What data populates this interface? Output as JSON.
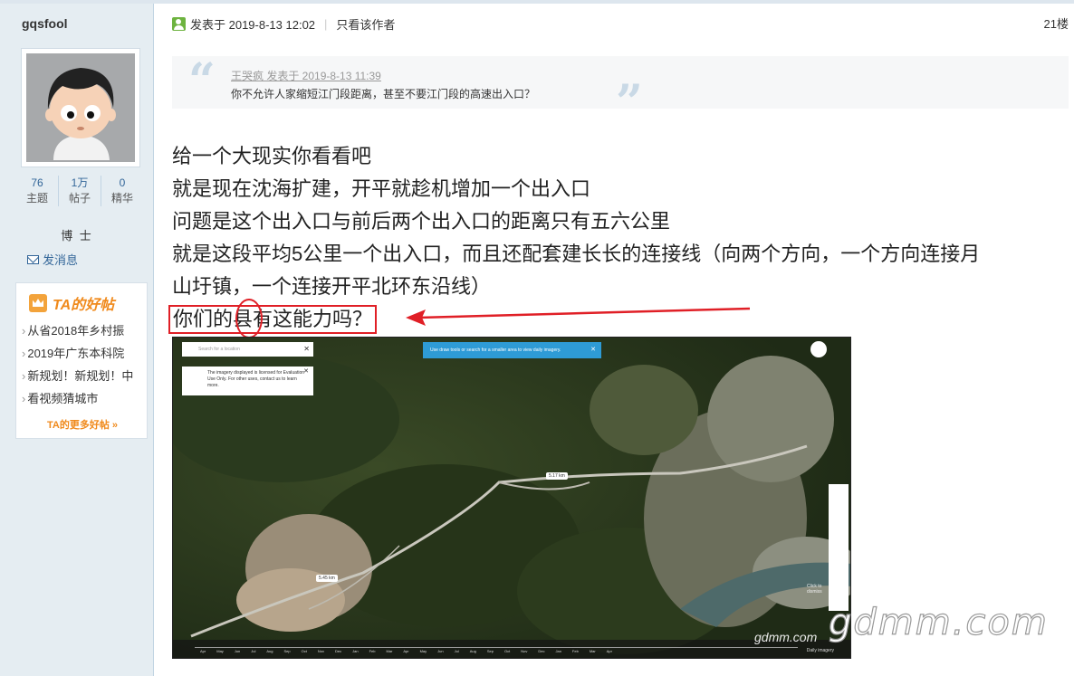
{
  "sidebar": {
    "username": "gqsfool",
    "stats": [
      {
        "num": "76",
        "label": "主题"
      },
      {
        "num": "1万",
        "label": "帖子"
      },
      {
        "num": "0",
        "label": "精华"
      }
    ],
    "rank": "博 士",
    "pm_label": "发消息",
    "hot": {
      "title": "TA的好帖",
      "items": [
        "从省2018年乡村振",
        "2019年广东本科院",
        "新规划！新规划！中",
        "看视频猜城市"
      ],
      "more": "TA的更多好帖 »"
    }
  },
  "post": {
    "posted": "发表于 2019-8-13 12:02",
    "only_author": "只看该作者",
    "floor": "21楼",
    "quote": {
      "meta": "王哭疯 发表于 2019-8-13 11:39",
      "text": "你不允许人家缩短江门段距离，甚至不要江门段的高速出入口？"
    },
    "lines": [
      "给一个大现实你看看吧",
      "就是现在沈海扩建，开平就趁机增加一个出入口",
      "问题是这个出入口与前后两个出入口的距离只有五六公里",
      "就是这段平均5公里一个出入口，而且还配套建长长的连接线（向两个方向，一个方向连接月",
      "山圩镇，一个连接开平北环东沿线）"
    ],
    "highlight": "你们的县有这能力吗？"
  },
  "map": {
    "search_placeholder": "Search for a location",
    "license": "The imagery displayed is licensed for Evaluation Use Only. For other uses, contact us to learn more.",
    "draw_tip": "Use draw tools or search for a smaller area to view daily imagery.",
    "dist1": "5.17 km",
    "dist2": "5.45 km",
    "click_note": "Click to dismiss",
    "daily": "Daily imagery",
    "months": [
      "Apr",
      "May",
      "Jun",
      "Jul",
      "Aug",
      "Sep",
      "Oct",
      "Nov",
      "Dec",
      "Jan",
      "Feb",
      "Mar",
      "Apr",
      "May",
      "Jun",
      "Jul",
      "Aug",
      "Sep",
      "Oct",
      "Nov",
      "Dec",
      "Jan",
      "Feb",
      "Mar",
      "Apr"
    ]
  },
  "watermark": {
    "big": "gdmm.com",
    "small": "gdmm.com"
  },
  "colors": {
    "accent": "#336699",
    "highlight": "#e01f26",
    "hot": "#f08a1c"
  }
}
